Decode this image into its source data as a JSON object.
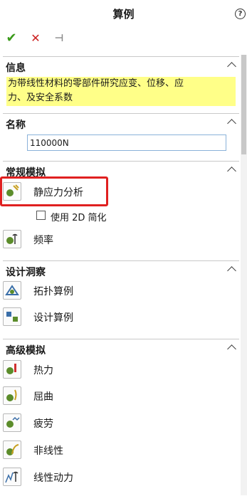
{
  "panel": {
    "title": "算例",
    "help_icon": "?"
  },
  "toolbar": {
    "ok_icon": "✔",
    "cancel_icon": "✕",
    "pin_icon": "⊣"
  },
  "info": {
    "title": "信息",
    "text_line1": "为带线性材料的零部件研究应变、位移、应",
    "text_line2": "力、及安全系数"
  },
  "name": {
    "title": "名称",
    "value": "110000N"
  },
  "general": {
    "title": "常规模拟",
    "items": [
      {
        "label": "静应力分析"
      },
      {
        "label": "频率"
      }
    ],
    "checkbox_label": "使用 2D 简化"
  },
  "design": {
    "title": "设计洞察",
    "items": [
      {
        "label": "拓扑算例"
      },
      {
        "label": "设计算例"
      }
    ]
  },
  "advanced": {
    "title": "高级模拟",
    "items": [
      {
        "label": "热力"
      },
      {
        "label": "屈曲"
      },
      {
        "label": "疲劳"
      },
      {
        "label": "非线性"
      },
      {
        "label": "线性动力"
      }
    ]
  },
  "colors": {
    "highlight_border": "#e02020",
    "info_background": "#ffff88",
    "ok": "#3a9a1a",
    "cancel": "#cc2020"
  }
}
